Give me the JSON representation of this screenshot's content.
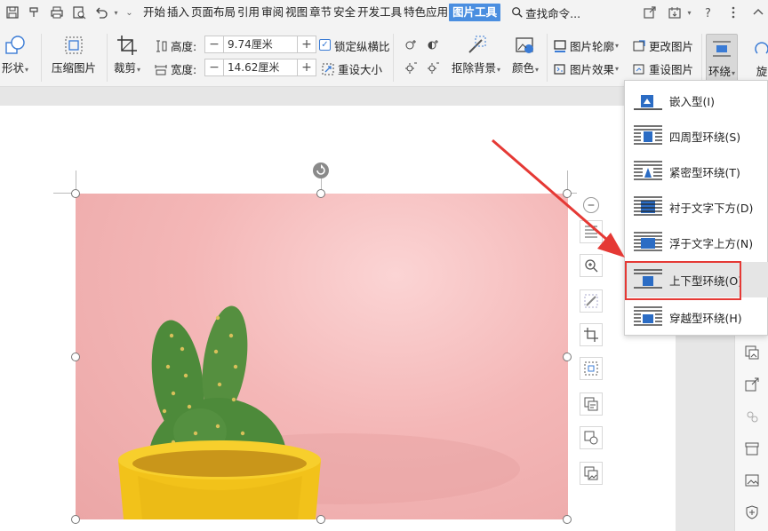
{
  "menubar": {
    "items": [
      "开始",
      "插入",
      "页面布局",
      "引用",
      "审阅",
      "视图",
      "章节",
      "安全",
      "开发工具",
      "特色应用",
      "图片工具"
    ],
    "active_item": "图片工具",
    "search_label": "查找命令..."
  },
  "ribbon": {
    "shape_label": "形状",
    "compress_label": "压缩图片",
    "crop_label": "裁剪",
    "height_label": "高度:",
    "height_value": "9.74厘米",
    "width_label": "宽度:",
    "width_value": "14.62厘米",
    "lock_ratio_label": "锁定纵横比",
    "lock_ratio_checked": true,
    "reset_size_label": "重设大小",
    "remove_bg_label": "抠除背景",
    "color_label": "颜色",
    "outline_label": "图片轮廓",
    "effect_label": "图片效果",
    "change_pic_label": "更改图片",
    "reset_pic_label": "重设图片",
    "wrap_label": "环绕",
    "rotate_label": "旋"
  },
  "wrap_menu": {
    "items": [
      {
        "label": "嵌入型(I)",
        "icon": "inline-wrap-icon"
      },
      {
        "label": "四周型环绕(S)",
        "icon": "square-wrap-icon"
      },
      {
        "label": "紧密型环绕(T)",
        "icon": "tight-wrap-icon"
      },
      {
        "label": "衬于文字下方(D)",
        "icon": "behind-text-icon"
      },
      {
        "label": "浮于文字上方(N)",
        "icon": "in-front-text-icon"
      },
      {
        "label": "上下型环绕(O)",
        "icon": "top-bottom-wrap-icon"
      },
      {
        "label": "穿越型环绕(H)",
        "icon": "through-wrap-icon"
      }
    ],
    "selected": "上下型环绕(O)"
  },
  "colors": {
    "accent": "#4a8ee0",
    "highlight_red": "#e53935",
    "pot_yellow": "#f2c21a",
    "cactus_green": "#4d8a3a",
    "background_pink": "#f4b7b7"
  }
}
